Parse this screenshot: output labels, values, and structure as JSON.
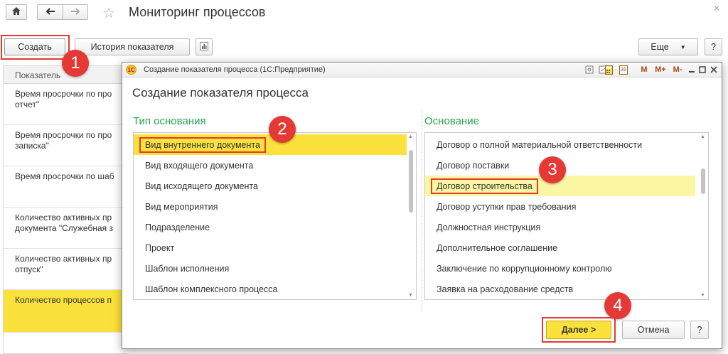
{
  "app": {
    "title": "Мониторинг процессов",
    "home_icon": "home-icon",
    "back_icon": "arrow-left-icon",
    "forward_icon": "arrow-right-icon",
    "favorite_icon": "star-icon",
    "close_glyph": "×"
  },
  "toolbar": {
    "create_label": "Создать",
    "history_label": "История показателя",
    "more_label": "Еще",
    "more_arrow": "▼",
    "help_label": "?"
  },
  "table": {
    "header": "Показатель",
    "rows": [
      {
        "line1": "Время просрочки по про",
        "line2": "отчет\""
      },
      {
        "line1": "Время просрочки по про",
        "line2": "записка\""
      },
      {
        "line1": "Время просрочки по шаб",
        "line2": ""
      },
      {
        "line1": "Количество активных пр",
        "line2": "документа \"Служебная з"
      },
      {
        "line1": "Количество активных пр",
        "line2": "отпуск\""
      },
      {
        "line1": "Количество процессов п",
        "line2": ""
      }
    ]
  },
  "dialog": {
    "window_title": "Создание показателя процесса  (1С:Предприятие)",
    "logo_text": "1С",
    "heading": "Создание показателя процесса",
    "left_label": "Тип основания",
    "right_label": "Основание",
    "left_items": [
      "Вид внутреннего документа",
      "Вид входящего документа",
      "Вид исходящего документа",
      "Вид мероприятия",
      "Подразделение",
      "Проект",
      "Шаблон исполнения",
      "Шаблон комплексного процесса"
    ],
    "right_items": [
      "Договор о полной материальной ответственности",
      "Договор поставки",
      "Договор строительства",
      "Договор уступки прав требования",
      "Должностная инструкция",
      "Дополнительное соглашение",
      "Заключение по коррупционному контролю",
      "Заявка на расходование средств"
    ],
    "left_selected_index": 0,
    "right_selected_index": 2,
    "title_buttons": {
      "m": "M",
      "mplus": "M+",
      "mminus": "M-",
      "calendar": "31"
    },
    "next_label": "Далее >",
    "cancel_label": "Отмена",
    "help_label": "?"
  },
  "callouts": [
    "1",
    "2",
    "3",
    "4"
  ],
  "colors": {
    "selection": "#fbe13c",
    "highlight": "#fbf6a3",
    "callout": "#e53935",
    "section_label": "#29a34f"
  }
}
